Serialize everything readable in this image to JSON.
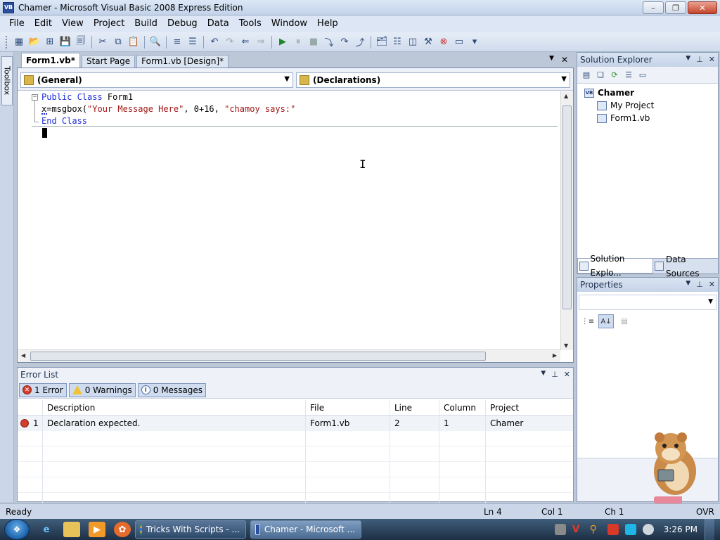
{
  "window": {
    "title": "Chamer - Microsoft Visual Basic 2008 Express Edition",
    "app_icon_text": "VB",
    "minimize": "–",
    "restore": "❐",
    "close": "✕"
  },
  "menu": [
    "File",
    "Edit",
    "View",
    "Project",
    "Build",
    "Debug",
    "Data",
    "Tools",
    "Window",
    "Help"
  ],
  "toolbox": {
    "label": "Toolbox"
  },
  "doc_tabs": {
    "tabs": [
      "Form1.vb*",
      "Start Page",
      "Form1.vb [Design]*"
    ],
    "active_index": 0,
    "dropdown": "▼",
    "close": "✕"
  },
  "editor": {
    "class_combo": "(General)",
    "method_combo": "(Declarations)",
    "lines": [
      {
        "kw1": "Public Class",
        "rest": " Form1"
      },
      {
        "pre": "x=msgbox(",
        "str1": "\"Your Message Here\"",
        "mid": ", 0+16, ",
        "str2": "\"chamoy says:\""
      },
      {
        "kw1": "End Class"
      }
    ],
    "fold_glyph": "−"
  },
  "solution_explorer": {
    "title": "Solution Explorer",
    "root": "Chamer",
    "items": [
      "My Project",
      "Form1.vb"
    ],
    "tabs": [
      "Solution Explo...",
      "Data Sources"
    ]
  },
  "properties": {
    "title": "Properties"
  },
  "error_list": {
    "title": "Error List",
    "filters": {
      "errors": "1 Error",
      "warnings": "0 Warnings",
      "messages": "0 Messages"
    },
    "columns": [
      "",
      "Description",
      "File",
      "Line",
      "Column",
      "Project"
    ],
    "rows": [
      {
        "num": "1",
        "description": "Declaration expected.",
        "file": "Form1.vb",
        "line": "2",
        "column": "1",
        "project": "Chamer"
      }
    ]
  },
  "status_bar": {
    "state": "Ready",
    "ln": "Ln 4",
    "col": "Col 1",
    "ch": "Ch 1",
    "ovr": "OVR"
  },
  "taskbar": {
    "tasks": [
      "Tricks With Scripts - ...",
      "Chamer - Microsoft ..."
    ],
    "active_index": 1,
    "clock": "3:26 PM"
  },
  "colors": {
    "keyword": "#1e2fd8",
    "string": "#a31515",
    "error": "#d43c2c"
  }
}
